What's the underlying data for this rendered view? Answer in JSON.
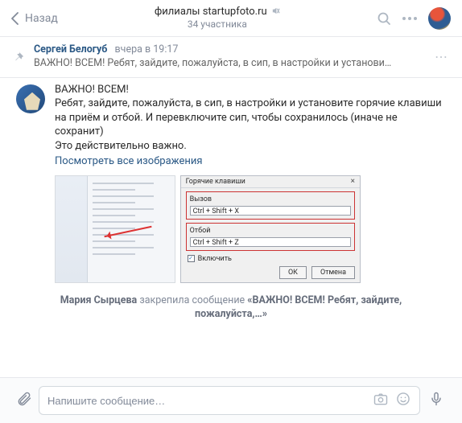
{
  "header": {
    "back_label": "Назад",
    "title": "филиалы startupfoto.ru",
    "subtitle": "34 участника"
  },
  "pinned": {
    "author": "Сергей Белогуб",
    "time": "вчера в 19:17",
    "preview": "ВАЖНО! ВСЕМ! Ребят, зайдите, пожалуйста, в сип, в настройки и установи…",
    "more": "⋯"
  },
  "message": {
    "lines": [
      "ВАЖНО! ВСЕМ!",
      "Ребят, зайдите, пожалуйста, в сип, в настройки и установите горячие клавиши на приём и отбой. И перевключите сип, чтобы сохранилось (иначе не сохранит)",
      "Это действительно важно."
    ],
    "see_all": "Посмотреть все изображения"
  },
  "hotkeys_dialog": {
    "title": "Горячие клавиши",
    "close": "×",
    "groups": [
      {
        "label": "Вызов",
        "value": "Ctrl + Shift + X"
      },
      {
        "label": "Отбой",
        "value": "Ctrl + Shift + Z"
      }
    ],
    "checkbox": "Включить",
    "buttons": {
      "ok": "ОК",
      "cancel": "Отмена"
    }
  },
  "pin_notice": {
    "who": "Мария Сырцева",
    "action": "закрепила сообщение",
    "what": "«ВАЖНО! ВСЕМ! Ребят, зайдите, пожалуйста,…»"
  },
  "composer": {
    "placeholder": "Напишите сообщение…"
  }
}
